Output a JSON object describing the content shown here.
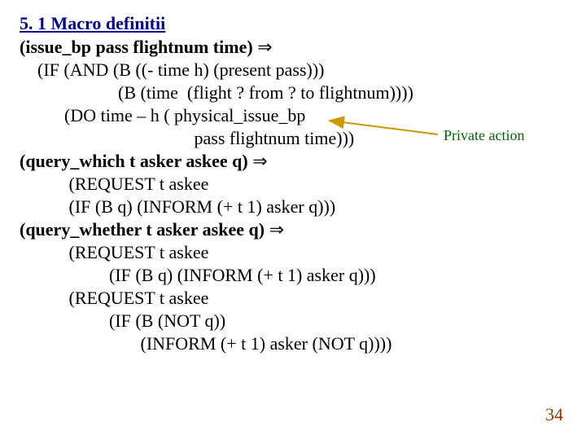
{
  "title": "5. 1 Macro definitii",
  "arrow_implies": "⇒",
  "lines": {
    "l0_head": "(issue_bp pass flightnum time)",
    "l1": "    (IF (AND (B ((- time h) (present pass)))",
    "l2": "                      (B (time  (flight ? from ? to flightnum))))",
    "l3": "          (DO time – h ( physical_issue_bp",
    "l4": "                                       pass flightnum time)))",
    "qw_head": "(query_which t asker askee q)",
    "l6": "           (REQUEST t askee",
    "l7": "           (IF (B q) (INFORM (+ t 1) asker q)))",
    "qr_head": "(query_whether t asker askee q)",
    "l9": "           (REQUEST t askee",
    "l10": "                    (IF (B q) (INFORM (+ t 1) asker q)))",
    "l11": "           (REQUEST t askee",
    "l12": "                    (IF (B (NOT q))",
    "l13": "                           (INFORM (+ t 1) asker (NOT q))))"
  },
  "annotation": "Private action",
  "page_number": "34"
}
